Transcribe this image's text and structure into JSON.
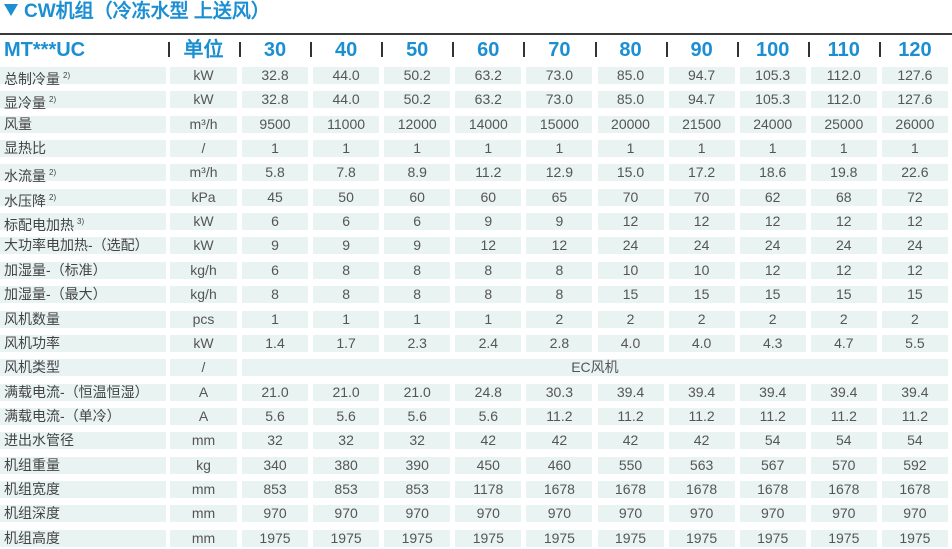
{
  "title": "CW机组（冷冻水型 上送风）",
  "header": {
    "model": "MT***UC",
    "unit": "单位",
    "models": [
      "30",
      "40",
      "50",
      "60",
      "70",
      "80",
      "90",
      "100",
      "110",
      "120"
    ]
  },
  "colors": {
    "accent": "#1b8fd2",
    "row_bg": "#e9f3f2",
    "text": "#555555"
  },
  "rows": [
    {
      "label": "总制冷量",
      "note": "2)",
      "unit": "kW",
      "values": [
        "32.8",
        "44.0",
        "50.2",
        "63.2",
        "73.0",
        "85.0",
        "94.7",
        "105.3",
        "112.0",
        "127.6"
      ]
    },
    {
      "label": "显冷量",
      "note": "2)",
      "unit": "kW",
      "values": [
        "32.8",
        "44.0",
        "50.2",
        "63.2",
        "73.0",
        "85.0",
        "94.7",
        "105.3",
        "112.0",
        "127.6"
      ]
    },
    {
      "label": "风量",
      "note": "",
      "unit": "m³/h",
      "values": [
        "9500",
        "11000",
        "12000",
        "14000",
        "15000",
        "20000",
        "21500",
        "24000",
        "25000",
        "26000"
      ]
    },
    {
      "label": "显热比",
      "note": "",
      "unit": "/",
      "values": [
        "1",
        "1",
        "1",
        "1",
        "1",
        "1",
        "1",
        "1",
        "1",
        "1"
      ]
    },
    {
      "label": "水流量",
      "note": "2)",
      "unit": "m³/h",
      "values": [
        "5.8",
        "7.8",
        "8.9",
        "11.2",
        "12.9",
        "15.0",
        "17.2",
        "18.6",
        "19.8",
        "22.6"
      ]
    },
    {
      "label": "水压降",
      "note": "2)",
      "unit": "kPa",
      "values": [
        "45",
        "50",
        "60",
        "60",
        "65",
        "70",
        "70",
        "62",
        "68",
        "72"
      ]
    },
    {
      "label": "标配电加热",
      "note": "3)",
      "unit": "kW",
      "values": [
        "6",
        "6",
        "6",
        "9",
        "9",
        "12",
        "12",
        "12",
        "12",
        "12"
      ]
    },
    {
      "label": "大功率电加热-（选配）",
      "note": "",
      "unit": "kW",
      "values": [
        "9",
        "9",
        "9",
        "12",
        "12",
        "24",
        "24",
        "24",
        "24",
        "24"
      ]
    },
    {
      "label": "加湿量-（标准）",
      "note": "",
      "unit": "kg/h",
      "values": [
        "6",
        "8",
        "8",
        "8",
        "8",
        "10",
        "10",
        "12",
        "12",
        "12"
      ]
    },
    {
      "label": "加湿量-（最大）",
      "note": "",
      "unit": "kg/h",
      "values": [
        "8",
        "8",
        "8",
        "8",
        "8",
        "15",
        "15",
        "15",
        "15",
        "15"
      ]
    },
    {
      "label": "风机数量",
      "note": "",
      "unit": "pcs",
      "values": [
        "1",
        "1",
        "1",
        "1",
        "2",
        "2",
        "2",
        "2",
        "2",
        "2"
      ]
    },
    {
      "label": "风机功率",
      "note": "",
      "unit": "kW",
      "values": [
        "1.4",
        "1.7",
        "2.3",
        "2.4",
        "2.8",
        "4.0",
        "4.0",
        "4.3",
        "4.7",
        "5.5"
      ]
    },
    {
      "label": "风机类型",
      "note": "",
      "unit": "/",
      "merged": "EC风机"
    },
    {
      "label": "满载电流-（恒温恒湿）",
      "note": "",
      "unit": "A",
      "values": [
        "21.0",
        "21.0",
        "21.0",
        "24.8",
        "30.3",
        "39.4",
        "39.4",
        "39.4",
        "39.4",
        "39.4"
      ]
    },
    {
      "label": "满载电流-（单冷）",
      "note": "",
      "unit": "A",
      "values": [
        "5.6",
        "5.6",
        "5.6",
        "5.6",
        "11.2",
        "11.2",
        "11.2",
        "11.2",
        "11.2",
        "11.2"
      ]
    },
    {
      "label": "进出水管径",
      "note": "",
      "unit": "mm",
      "values": [
        "32",
        "32",
        "32",
        "42",
        "42",
        "42",
        "42",
        "54",
        "54",
        "54"
      ]
    },
    {
      "label": "机组重量",
      "note": "",
      "unit": "kg",
      "values": [
        "340",
        "380",
        "390",
        "450",
        "460",
        "550",
        "563",
        "567",
        "570",
        "592"
      ]
    },
    {
      "label": "机组宽度",
      "note": "",
      "unit": "mm",
      "values": [
        "853",
        "853",
        "853",
        "1178",
        "1678",
        "1678",
        "1678",
        "1678",
        "1678",
        "1678"
      ]
    },
    {
      "label": "机组深度",
      "note": "",
      "unit": "mm",
      "values": [
        "970",
        "970",
        "970",
        "970",
        "970",
        "970",
        "970",
        "970",
        "970",
        "970"
      ]
    },
    {
      "label": "机组高度",
      "note": "",
      "unit": "mm",
      "values": [
        "1975",
        "1975",
        "1975",
        "1975",
        "1975",
        "1975",
        "1975",
        "1975",
        "1975",
        "1975"
      ]
    }
  ]
}
